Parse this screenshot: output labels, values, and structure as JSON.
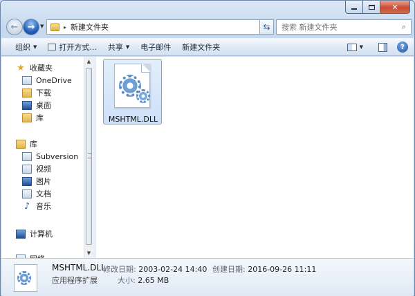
{
  "window": {
    "caption": {
      "min_icon": "minimize-icon",
      "max_icon": "maximize-icon",
      "close_glyph": "✕"
    }
  },
  "nav": {
    "back_icon": "back-arrow-icon",
    "forward_icon": "forward-arrow-icon",
    "address": {
      "path_segment": "新建文件夹",
      "separator": "▸"
    },
    "search_placeholder": "搜索 新建文件夹"
  },
  "toolbar": {
    "organize": "组织",
    "open_with": "打开方式...",
    "share": "共享",
    "email": "电子邮件",
    "new_folder": "新建文件夹"
  },
  "sidebar": {
    "favorites": {
      "label": "收藏夹",
      "items": [
        {
          "label": "OneDrive",
          "icon": "onedrive-icon"
        },
        {
          "label": "下载",
          "icon": "downloads-folder-icon"
        },
        {
          "label": "桌面",
          "icon": "desktop-icon"
        },
        {
          "label": "库",
          "icon": "libraries-icon"
        }
      ]
    },
    "libraries": {
      "label": "库",
      "items": [
        {
          "label": "Subversion",
          "icon": "subversion-icon"
        },
        {
          "label": "视频",
          "icon": "video-icon"
        },
        {
          "label": "图片",
          "icon": "pictures-icon"
        },
        {
          "label": "文档",
          "icon": "documents-icon"
        },
        {
          "label": "音乐",
          "icon": "music-icon"
        }
      ]
    },
    "computer": "计算机",
    "network": "网络"
  },
  "content": {
    "files": [
      {
        "name": "MSHTML.DLL",
        "icon": "dll-file-gear-icon",
        "selected": true
      }
    ]
  },
  "details": {
    "name": "MSHTML.DLL",
    "type": "应用程序扩展",
    "modified_label": "修改日期:",
    "modified_value": "2003-02-24 14:40",
    "created_label": "创建日期:",
    "created_value": "2016-09-26 11:11",
    "size_label": "大小:",
    "size_value": "2.65 MB"
  },
  "colors": {
    "frame": "#c6d9ee",
    "selection": "#cde0f7",
    "close_button": "#c94c34"
  }
}
